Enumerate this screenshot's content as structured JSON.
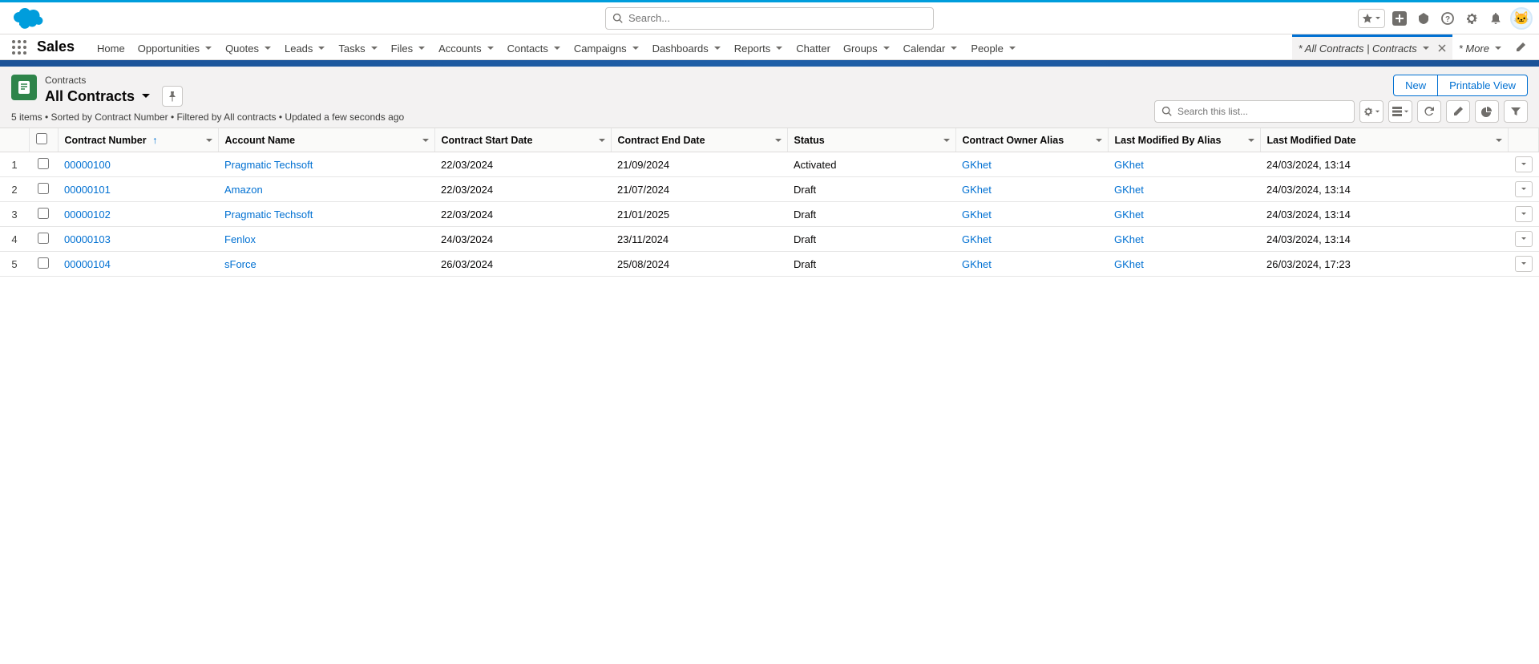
{
  "global": {
    "search_placeholder": "Search...",
    "app_name": "Sales"
  },
  "nav": {
    "items": [
      {
        "label": "Home",
        "has_menu": false
      },
      {
        "label": "Opportunities",
        "has_menu": true
      },
      {
        "label": "Quotes",
        "has_menu": true
      },
      {
        "label": "Leads",
        "has_menu": true
      },
      {
        "label": "Tasks",
        "has_menu": true
      },
      {
        "label": "Files",
        "has_menu": true
      },
      {
        "label": "Accounts",
        "has_menu": true
      },
      {
        "label": "Contacts",
        "has_menu": true
      },
      {
        "label": "Campaigns",
        "has_menu": true
      },
      {
        "label": "Dashboards",
        "has_menu": true
      },
      {
        "label": "Reports",
        "has_menu": true
      },
      {
        "label": "Chatter",
        "has_menu": false
      },
      {
        "label": "Groups",
        "has_menu": true
      },
      {
        "label": "Calendar",
        "has_menu": true
      },
      {
        "label": "People",
        "has_menu": true
      }
    ],
    "active_tab": "* All Contracts | Contracts",
    "more": "* More"
  },
  "page": {
    "object_label": "Contracts",
    "view_name": "All Contracts",
    "meta": "5 items • Sorted by Contract Number • Filtered by All contracts • Updated a few seconds ago",
    "new_btn": "New",
    "printable_btn": "Printable View",
    "list_search_placeholder": "Search this list..."
  },
  "table": {
    "columns": [
      "Contract Number",
      "Account Name",
      "Contract Start Date",
      "Contract End Date",
      "Status",
      "Contract Owner Alias",
      "Last Modified By Alias",
      "Last Modified Date"
    ],
    "sorted_col_index": 0,
    "rows": [
      {
        "num": "1",
        "contract": "00000100",
        "account": "Pragmatic Techsoft",
        "start": "22/03/2024",
        "end": "21/09/2024",
        "status": "Activated",
        "owner": "GKhet",
        "modby": "GKhet",
        "moddate": "24/03/2024, 13:14"
      },
      {
        "num": "2",
        "contract": "00000101",
        "account": "Amazon",
        "start": "22/03/2024",
        "end": "21/07/2024",
        "status": "Draft",
        "owner": "GKhet",
        "modby": "GKhet",
        "moddate": "24/03/2024, 13:14"
      },
      {
        "num": "3",
        "contract": "00000102",
        "account": "Pragmatic Techsoft",
        "start": "22/03/2024",
        "end": "21/01/2025",
        "status": "Draft",
        "owner": "GKhet",
        "modby": "GKhet",
        "moddate": "24/03/2024, 13:14"
      },
      {
        "num": "4",
        "contract": "00000103",
        "account": "Fenlox",
        "start": "24/03/2024",
        "end": "23/11/2024",
        "status": "Draft",
        "owner": "GKhet",
        "modby": "GKhet",
        "moddate": "24/03/2024, 13:14"
      },
      {
        "num": "5",
        "contract": "00000104",
        "account": "sForce",
        "start": "26/03/2024",
        "end": "25/08/2024",
        "status": "Draft",
        "owner": "GKhet",
        "modby": "GKhet",
        "moddate": "26/03/2024, 17:23"
      }
    ]
  }
}
